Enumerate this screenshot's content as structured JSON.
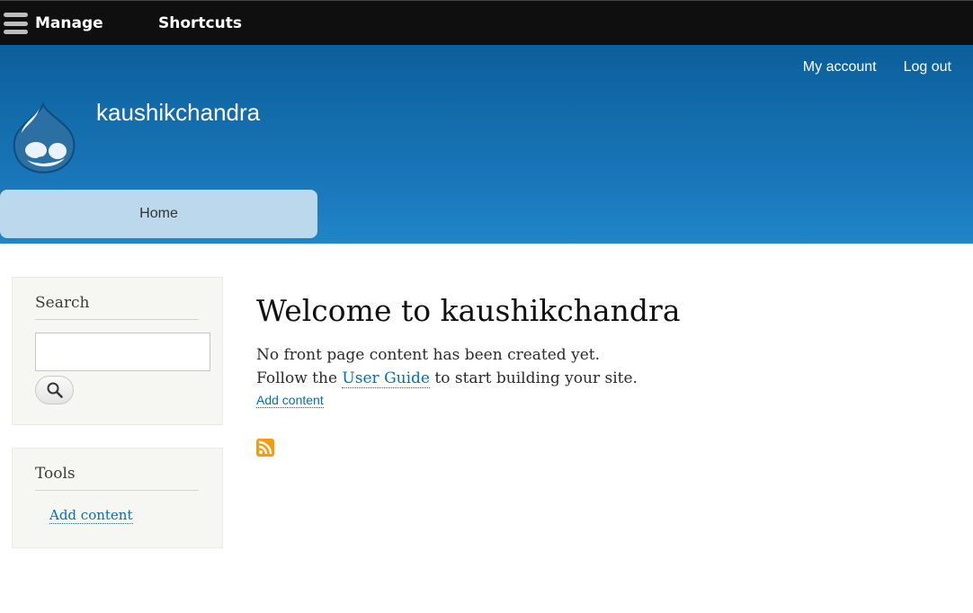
{
  "toolbar": {
    "manage_label": "Manage",
    "shortcuts_label": "Shortcuts"
  },
  "header": {
    "secondary_menu": [
      "My account",
      "Log out"
    ],
    "site_name": "kaushikchandra",
    "nav": [
      "Home"
    ]
  },
  "sidebar": {
    "search": {
      "title": "Search",
      "input_value": ""
    },
    "tools": {
      "title": "Tools",
      "links": [
        "Add content"
      ]
    }
  },
  "main": {
    "title": "Welcome to kaushikchandra",
    "line1": "No front page content has been created yet.",
    "line2_before": "Follow the",
    "line2_link": "User Guide",
    "line2_after": "to start building your site.",
    "add_content": "Add content"
  },
  "colors": {
    "toolbar_bg": "#0f0f0f",
    "header_top": "#0b5f9a",
    "header_bottom": "#1f86c8",
    "link": "#0071b3",
    "rss": "#f39c12"
  }
}
